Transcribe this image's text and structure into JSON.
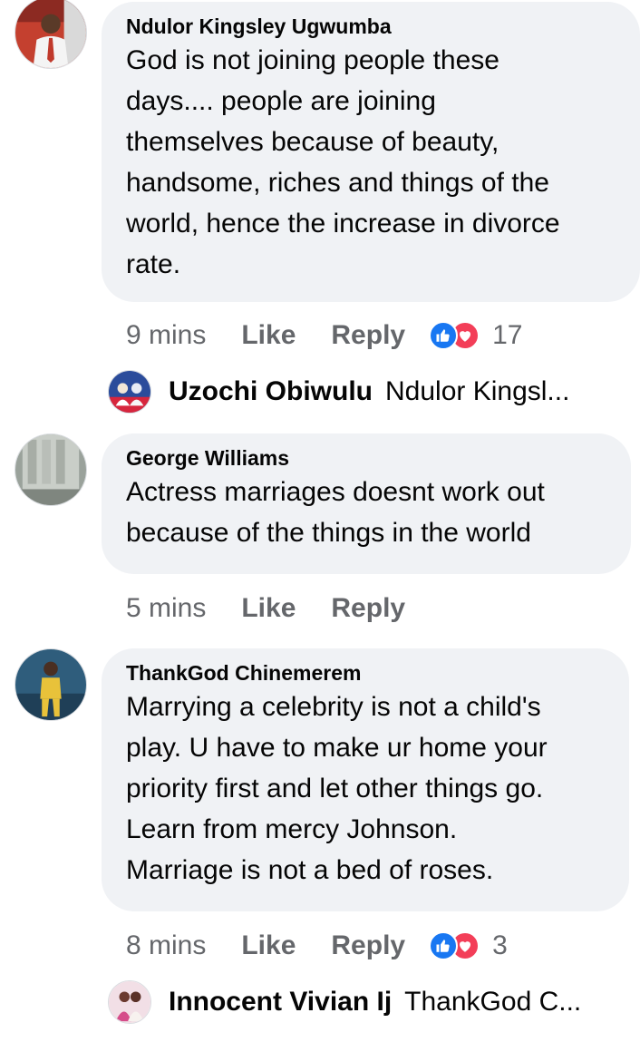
{
  "comments": [
    {
      "author": "Ndulor Kingsley Ugwumba",
      "lines": [
        "God is not joining people these",
        "days.... people are joining",
        "themselves because of beauty,",
        "handsome, riches and things of the",
        "world, hence the increase in divorce",
        "rate."
      ],
      "time": "9 mins",
      "like_label": "Like",
      "reply_label": "Reply",
      "reaction_icons": [
        "like-icon",
        "love-icon"
      ],
      "reaction_count": "17",
      "reply_preview": {
        "name": "Uzochi Obiwulu",
        "snippet": "Ndulor Kingsl..."
      }
    },
    {
      "author": "George Williams",
      "lines": [
        "Actress marriages doesnt work out",
        "because of the things in the world"
      ],
      "time": "5 mins",
      "like_label": "Like",
      "reply_label": "Reply"
    },
    {
      "author": "ThankGod Chinemerem",
      "lines": [
        "Marrying a celebrity is not a child's",
        "play. U have to make ur home your",
        "priority first and let other things go.",
        "Learn from mercy Johnson.",
        "Marriage is not a bed of roses."
      ],
      "time": "8 mins",
      "like_label": "Like",
      "reply_label": "Reply",
      "reaction_icons": [
        "like-icon",
        "love-icon"
      ],
      "reaction_count": "3",
      "reply_preview": {
        "name": "Innocent Vivian Ij",
        "snippet": "ThankGod C..."
      }
    }
  ],
  "colors": {
    "bubble_bg": "#f0f2f5",
    "meta_text": "#65676b",
    "like_blue": "#1877f2",
    "love_red": "#f33e58"
  }
}
